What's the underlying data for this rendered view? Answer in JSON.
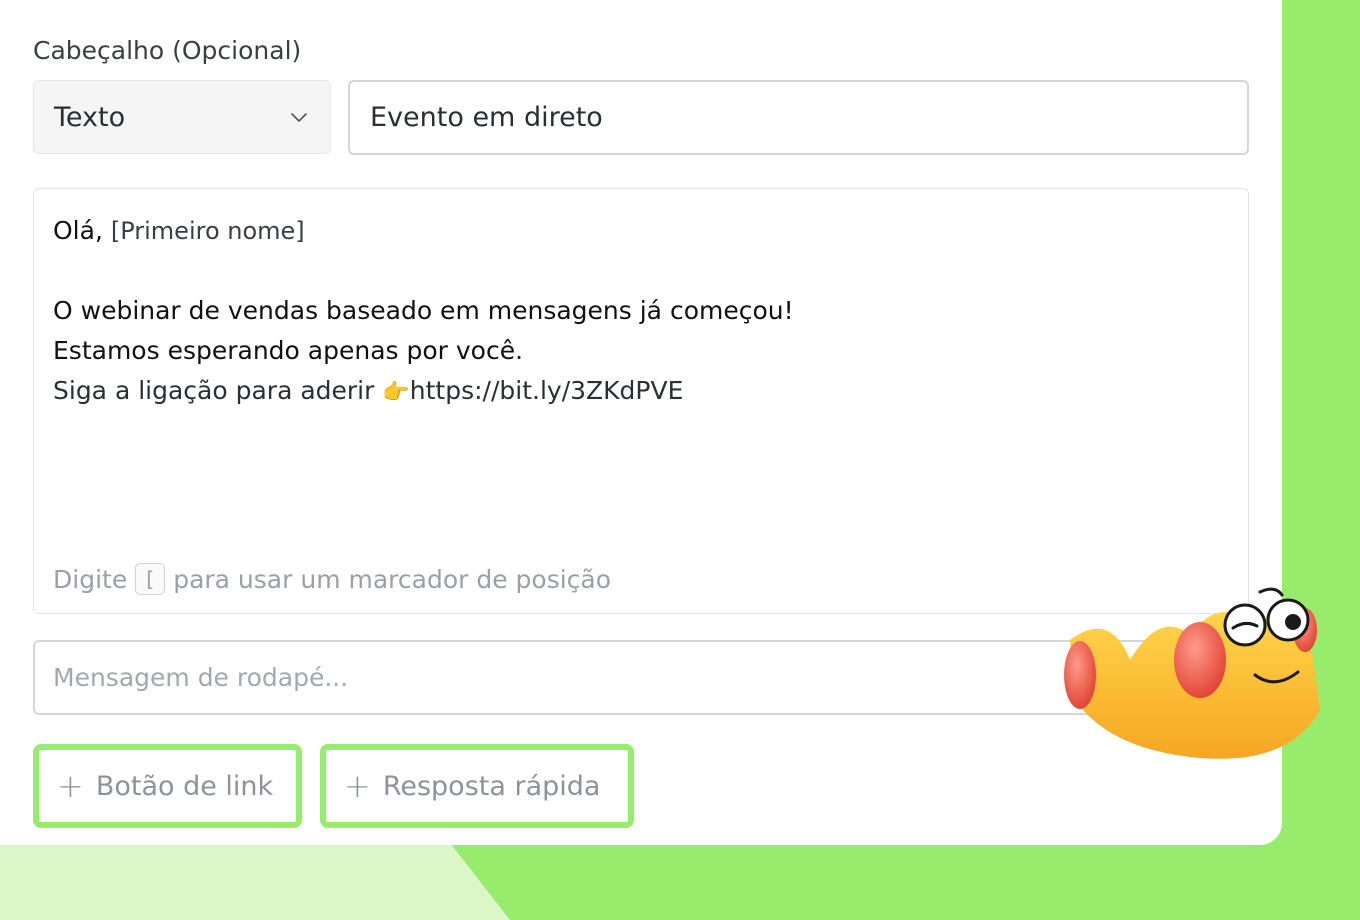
{
  "header_section": {
    "label": "Cabeçalho (Opcional)",
    "type_select": {
      "value": "Texto"
    },
    "header_text": "Evento em direto"
  },
  "message_body": {
    "greeting_prefix": "Olá,",
    "greeting_placeholder": "[Primeiro nome]",
    "line1": "O webinar de vendas baseado em mensagens já começou!",
    "line2": "Estamos esperando apenas por você.",
    "line3_prefix": "Siga a ligação para aderir",
    "line3_emoji": "👉",
    "line3_url": "https://bit.ly/3ZKdPVE",
    "hint_before": "Digite",
    "hint_key": "[",
    "hint_after": "para usar um marcador de posição"
  },
  "footer": {
    "placeholder": "Mensagem de rodapé..."
  },
  "buttons": {
    "link_button": "Botão de link",
    "quick_reply": "Resposta rápida"
  },
  "colors": {
    "accent_green": "#98ec6c",
    "light_green": "#dcf7c7"
  },
  "icons": {
    "dropdown": "chevron-down-icon",
    "add": "plus-icon",
    "decoration": "crown-mascot"
  }
}
